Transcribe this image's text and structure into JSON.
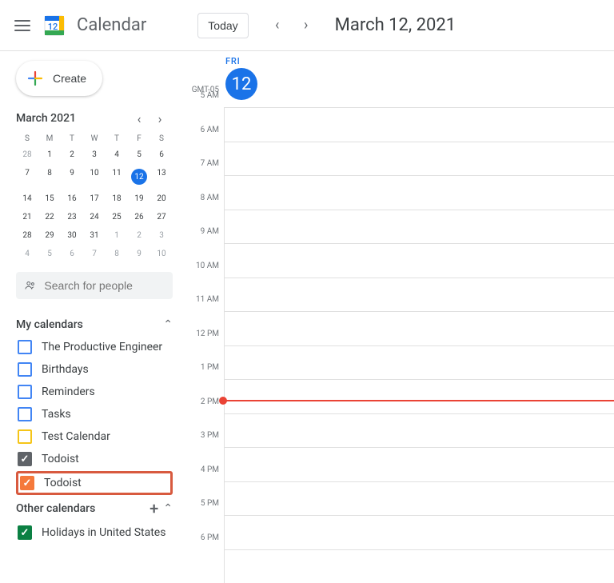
{
  "header": {
    "app_title": "Calendar",
    "today_label": "Today",
    "date_title": "March 12, 2021"
  },
  "sidebar": {
    "create_label": "Create",
    "mini_month": "March 2021",
    "dow": [
      "S",
      "M",
      "T",
      "W",
      "T",
      "F",
      "S"
    ],
    "weeks": [
      [
        {
          "n": 28,
          "muted": true
        },
        {
          "n": 1
        },
        {
          "n": 2
        },
        {
          "n": 3
        },
        {
          "n": 4
        },
        {
          "n": 5
        },
        {
          "n": 6
        }
      ],
      [
        {
          "n": 7
        },
        {
          "n": 8
        },
        {
          "n": 9
        },
        {
          "n": 10
        },
        {
          "n": 11
        },
        {
          "n": 12,
          "selected": true
        },
        {
          "n": 13
        }
      ],
      [
        {
          "n": 14
        },
        {
          "n": 15
        },
        {
          "n": 16
        },
        {
          "n": 17
        },
        {
          "n": 18
        },
        {
          "n": 19
        },
        {
          "n": 20
        }
      ],
      [
        {
          "n": 21
        },
        {
          "n": 22
        },
        {
          "n": 23
        },
        {
          "n": 24
        },
        {
          "n": 25
        },
        {
          "n": 26
        },
        {
          "n": 27
        }
      ],
      [
        {
          "n": 28
        },
        {
          "n": 29
        },
        {
          "n": 30
        },
        {
          "n": 31
        },
        {
          "n": 1,
          "muted": true
        },
        {
          "n": 2,
          "muted": true
        },
        {
          "n": 3,
          "muted": true
        }
      ],
      [
        {
          "n": 4,
          "muted": true
        },
        {
          "n": 5,
          "muted": true
        },
        {
          "n": 6,
          "muted": true
        },
        {
          "n": 7,
          "muted": true
        },
        {
          "n": 8,
          "muted": true
        },
        {
          "n": 9,
          "muted": true
        },
        {
          "n": 10,
          "muted": true
        }
      ]
    ],
    "search_placeholder": "Search for people",
    "my_calendars_label": "My calendars",
    "my_calendars": [
      {
        "label": "The Productive Engineer",
        "color": "#4285f4",
        "checked": false
      },
      {
        "label": "Birthdays",
        "color": "#4285f4",
        "checked": false
      },
      {
        "label": "Reminders",
        "color": "#4285f4",
        "checked": false
      },
      {
        "label": "Tasks",
        "color": "#4285f4",
        "checked": false
      },
      {
        "label": "Test Calendar",
        "color": "#f5c518",
        "checked": false
      },
      {
        "label": "Todoist",
        "color": "#5f6368",
        "checked": true
      },
      {
        "label": "Todoist",
        "color": "#f5793b",
        "checked": true,
        "highlight": true
      }
    ],
    "other_calendars_label": "Other calendars",
    "other_calendars": [
      {
        "label": "Holidays in United States",
        "color": "#0b8043",
        "checked": true
      }
    ]
  },
  "dayview": {
    "tz": "GMT-05",
    "dow": "FRI",
    "daynum": "12",
    "hours": [
      "5 AM",
      "6 AM",
      "7 AM",
      "8 AM",
      "9 AM",
      "10 AM",
      "11 AM",
      "12 PM",
      "1 PM",
      "2 PM",
      "3 PM",
      "4 PM",
      "5 PM",
      "6 PM"
    ],
    "now_offset_hours": 8.6
  }
}
